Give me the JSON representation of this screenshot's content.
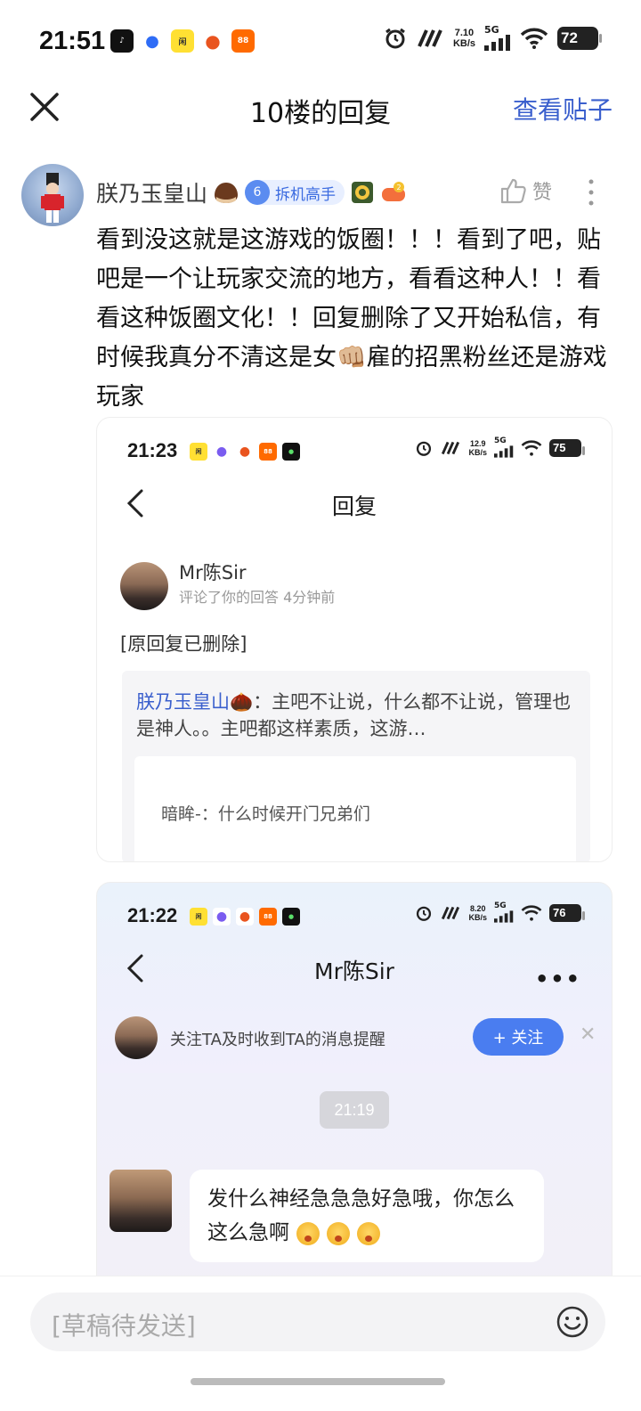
{
  "status_bar": {
    "time": "21:51",
    "net_speed_value": "7.10",
    "net_speed_unit": "KB/s",
    "signal": "5G",
    "battery": "72",
    "apps": [
      {
        "name": "tiktok-icon",
        "color": "#111111",
        "label": "♪"
      },
      {
        "name": "baidu-icon",
        "color": "#2e6cf6",
        "label": "●"
      },
      {
        "name": "xianyu-icon",
        "color": "#ffe033",
        "label": "闲"
      },
      {
        "name": "tomato-icon",
        "color": "#e9541f",
        "label": "●"
      },
      {
        "name": "taobao-icon",
        "color": "#ff6a00",
        "label": "88"
      }
    ]
  },
  "header": {
    "title": "10楼的回复",
    "view_post": "查看贴子"
  },
  "post": {
    "username": "朕乃玉皇山",
    "level": "6",
    "level_title": "拆机高手",
    "like_label": "赞",
    "text": "看到没这就是这游戏的饭圈！！！看到了吧，贴吧是一个让玩家交流的地方，看看这种人！！看看这种饭圈文化！！回复删除了又开始私信，有时候我真分不清这是女👊🏼雇的招黑粉丝还是游戏玩家"
  },
  "screenshot1": {
    "time": "21:23",
    "net_speed_value": "12.9",
    "net_speed_unit": "KB/s",
    "signal": "5G",
    "battery": "75",
    "title": "回复",
    "commenter": "Mr陈Sir",
    "sub": "评论了你的回答  4分钟前",
    "deleted": "[原回复已删除]",
    "quote_name": "朕乃玉皇山🌰",
    "quote_text": "：主吧不让说，什么都不让说，管理也是神人。。主吧都这样素质，这游…",
    "inner_text": "暗眸-：什么时候开门兄弟们"
  },
  "screenshot2": {
    "time": "21:22",
    "net_speed_value": "8.20",
    "net_speed_unit": "KB/s",
    "signal": "5G",
    "battery": "76",
    "title": "Mr陈Sir",
    "follow_prompt": "关注TA及时收到TA的消息提醒",
    "follow_button": "+ 关注",
    "time_chip": "21:19",
    "message": "发什么神经急急急好急哦，你怎么这么急啊"
  },
  "bottom": {
    "draft_placeholder": "[草稿待发送]"
  }
}
